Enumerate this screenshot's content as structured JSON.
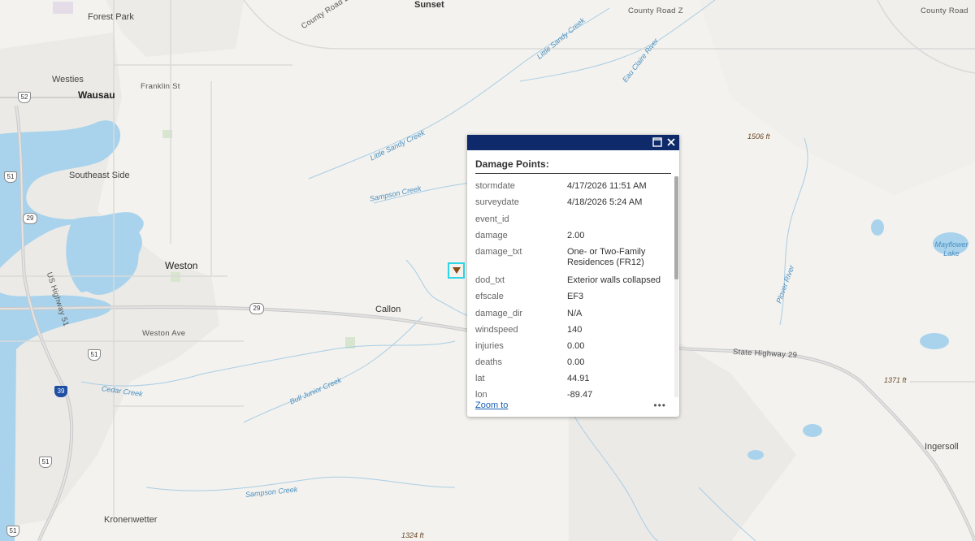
{
  "map": {
    "places": {
      "forest_park": "Forest Park",
      "sunset": "Sunset",
      "westies": "Westies",
      "wausau": "Wausau",
      "southeast_side": "Southeast Side",
      "weston": "Weston",
      "callon": "Callon",
      "kronenwetter": "Kronenwetter",
      "ingersoll": "Ingersoll",
      "mayflower_lake": "Mayflower Lake"
    },
    "roads": {
      "county_z_1": "County Road Z",
      "county_z_2": "County Road Z",
      "county_road_right": "County Road",
      "franklin": "Franklin St",
      "weston_ave": "Weston Ave",
      "state_hwy_29": "State Highway 29",
      "us_hwy_51": "US Highway 51"
    },
    "water": {
      "little_sandy_creek_1": "Little Sandy Creek",
      "little_sandy_creek_2": "Little Sandy Creek",
      "eau_claire": "Eau Claire River",
      "sampson_creek_1": "Sampson Creek",
      "sampson_creek_2": "Sampson Creek",
      "plover_river": "Plover River",
      "cedar_creek": "Cedar Creek",
      "bull_junior_creek": "Bull Junior Creek"
    },
    "elevations": {
      "e1506": "1506 ft",
      "e1371": "1371 ft",
      "e1324": "1324 ft"
    },
    "shields": {
      "s52": "52",
      "s51a": "51",
      "s29a": "29",
      "s29b": "29",
      "s51b": "51",
      "s39": "39",
      "s51c": "51",
      "s51d": "51"
    }
  },
  "popup": {
    "title": "Damage Points:",
    "maximize_icon": "maximize-icon",
    "close_icon": "close-icon",
    "zoom_label": "Zoom to",
    "more_label": "•••",
    "fields": [
      {
        "key": "stormdate",
        "value": "4/17/2026 11:51 AM"
      },
      {
        "key": "surveydate",
        "value": "4/18/2026 5:24 AM"
      },
      {
        "key": "event_id",
        "value": ""
      },
      {
        "key": "damage",
        "value": "2.00"
      },
      {
        "key": "damage_txt",
        "value": "One- or Two-Family Residences (FR12)"
      },
      {
        "key": "dod_txt",
        "value": "Exterior walls collapsed"
      },
      {
        "key": "efscale",
        "value": "EF3"
      },
      {
        "key": "damage_dir",
        "value": "N/A"
      },
      {
        "key": "windspeed",
        "value": "140"
      },
      {
        "key": "injuries",
        "value": "0.00"
      },
      {
        "key": "deaths",
        "value": "0.00"
      },
      {
        "key": "lat",
        "value": "44.91"
      },
      {
        "key": "lon",
        "value": "-89.47"
      }
    ]
  },
  "colors": {
    "header": "#0e2a6b",
    "marker_outline": "#2fd6e6",
    "water": "#a9d3ec"
  }
}
